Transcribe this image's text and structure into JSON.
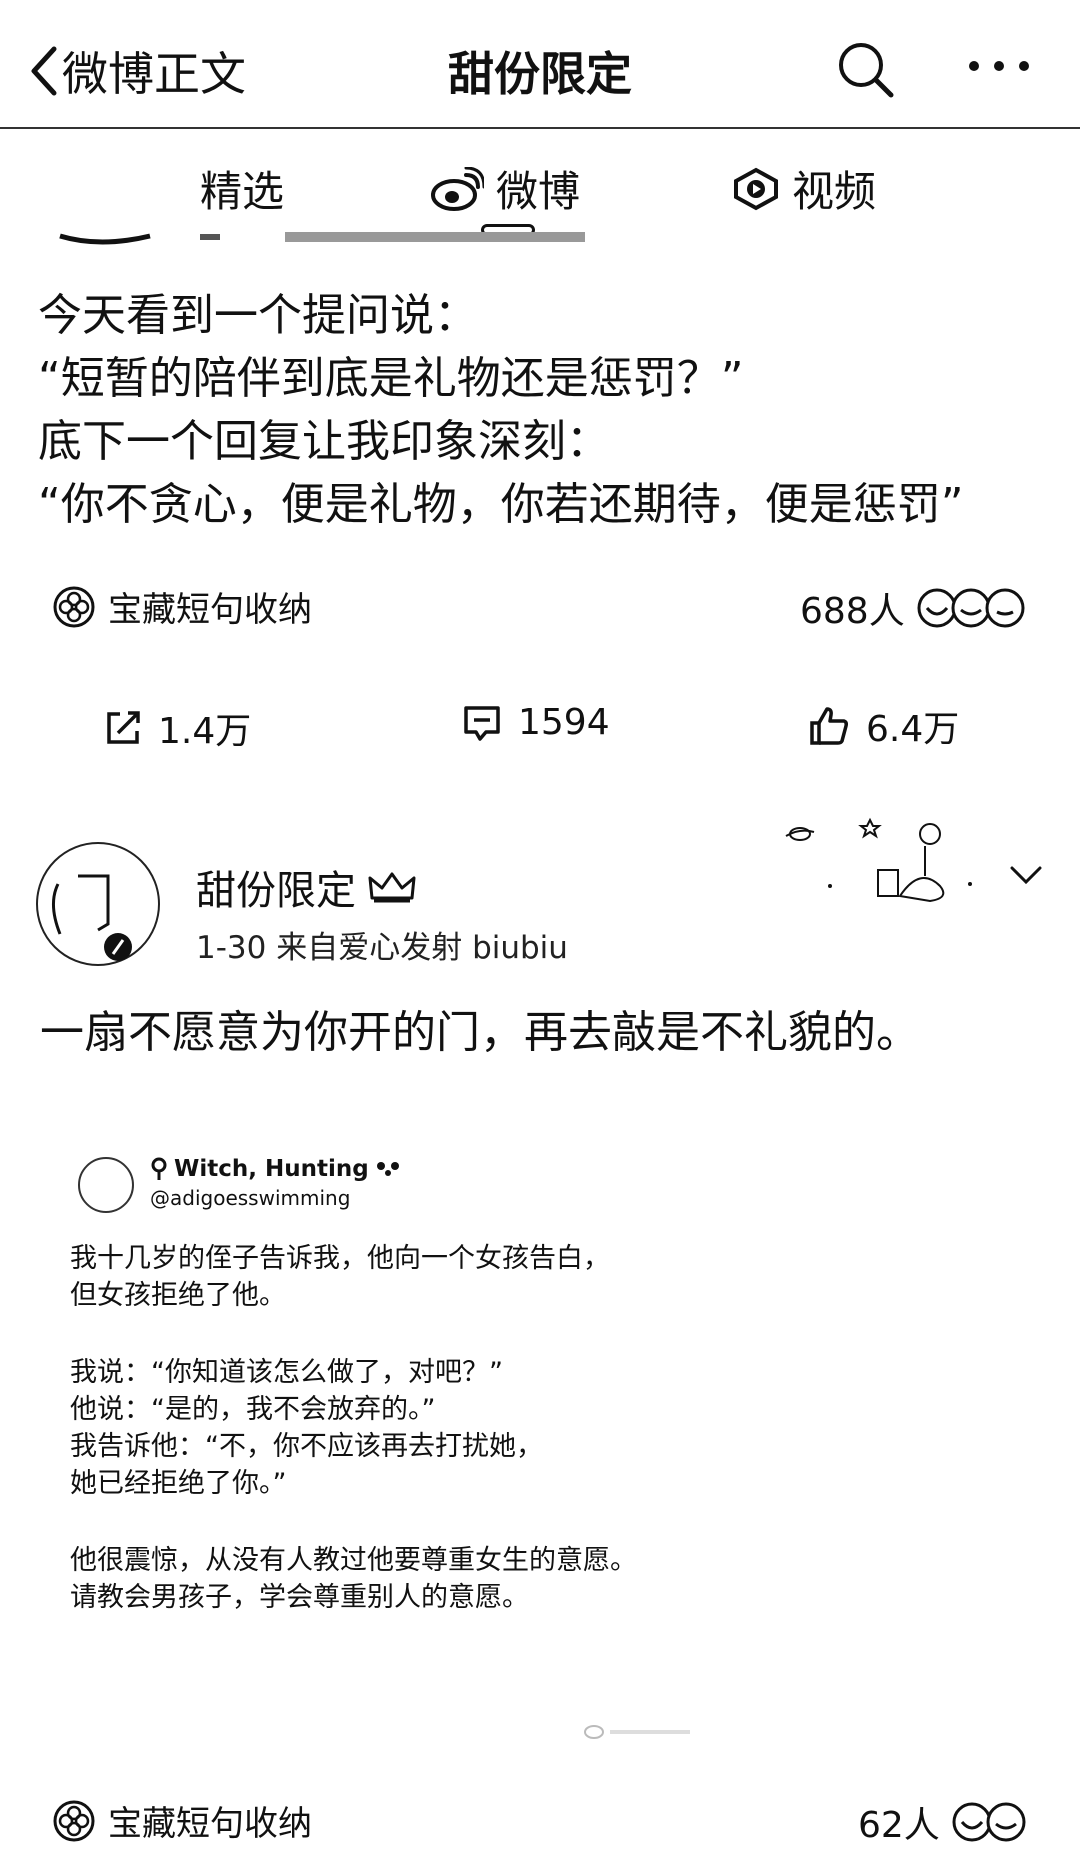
{
  "header": {
    "back_label": "微博正文",
    "title": "甜份限定"
  },
  "tabs": [
    {
      "label": "精选",
      "icon": "none"
    },
    {
      "label": "微博",
      "icon": "weibo-logo-icon",
      "active": true
    },
    {
      "label": "视频",
      "icon": "video-play-icon"
    }
  ],
  "post1": {
    "lines": [
      "今天看到一个提问说：",
      "“短暂的陪伴到底是礼物还是惩罚？”",
      "底下一个回复让我印象深刻：",
      "“你不贪心，便是礼物，你若还期待，便是惩罚”"
    ],
    "topic": "宝藏短句收纳",
    "people_count": "688人",
    "actions": {
      "repost": "1.4万",
      "comment": "1594",
      "like": "6.4万"
    }
  },
  "post2": {
    "author": "甜份限定",
    "meta": "1-30  来自爱心发射 biubiu",
    "text": "一扇不愿意为你开的门，再去敲是不礼貌的。",
    "tweet": {
      "name": "Witch, Hunting",
      "handle": "@adigoesswimming",
      "para1": [
        "我十几岁的侄子告诉我，他向一个女孩告白，",
        "但女孩拒绝了他。"
      ],
      "para2": [
        "我说：“你知道该怎么做了，对吧？”",
        "他说：“是的，我不会放弃的。”",
        "我告诉他：“不，你不应该再去打扰她，",
        "她已经拒绝了你。”"
      ],
      "para3": [
        "他很震惊，从没有人教过他要尊重女生的意愿。",
        "请教会男孩子，学会尊重别人的意愿。"
      ]
    },
    "topic": "宝藏短句收纳",
    "people_count": "62人"
  }
}
